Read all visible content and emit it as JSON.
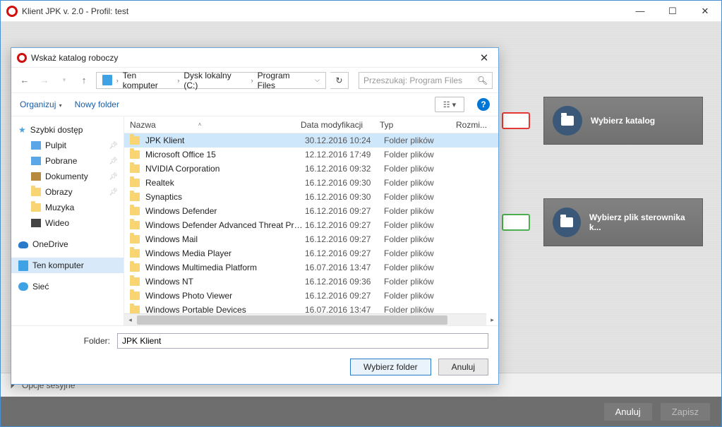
{
  "mainWindow": {
    "title": "Klient JPK v. 2.0 - Profil: test",
    "card1": "Wybierz katalog",
    "card2": "Wybierz plik sterownika k...",
    "session": "Opcje sesyjne",
    "footer": {
      "cancel": "Anuluj",
      "save": "Zapisz"
    }
  },
  "dialog": {
    "title": "Wskaż katalog roboczy",
    "breadcrumb": {
      "root": "Ten komputer",
      "drive": "Dysk lokalny (C:)",
      "folder": "Program Files"
    },
    "searchPlaceholder": "Przeszukaj: Program Files",
    "toolbar": {
      "organize": "Organizuj",
      "newFolder": "Nowy folder"
    },
    "tree": {
      "quick": "Szybki dostęp",
      "items": [
        {
          "label": "Pulpit",
          "pin": true,
          "icon": "blue"
        },
        {
          "label": "Pobrane",
          "pin": true,
          "icon": "blue"
        },
        {
          "label": "Dokumenty",
          "pin": true,
          "icon": "doc"
        },
        {
          "label": "Obrazy",
          "pin": true,
          "icon": "folder"
        },
        {
          "label": "Muzyka",
          "pin": false,
          "icon": "folder"
        },
        {
          "label": "Wideo",
          "pin": false,
          "icon": "vid"
        }
      ],
      "oneDrive": "OneDrive",
      "thisPc": "Ten komputer",
      "network": "Sieć"
    },
    "columns": {
      "name": "Nazwa",
      "date": "Data modyfikacji",
      "type": "Typ",
      "size": "Rozmi..."
    },
    "rows": [
      {
        "name": "JPK Klient",
        "date": "30.12.2016 10:24",
        "type": "Folder plików",
        "selected": true
      },
      {
        "name": "Microsoft Office 15",
        "date": "12.12.2016 17:49",
        "type": "Folder plików"
      },
      {
        "name": "NVIDIA Corporation",
        "date": "16.12.2016 09:32",
        "type": "Folder plików"
      },
      {
        "name": "Realtek",
        "date": "16.12.2016 09:30",
        "type": "Folder plików"
      },
      {
        "name": "Synaptics",
        "date": "16.12.2016 09:30",
        "type": "Folder plików"
      },
      {
        "name": "Windows Defender",
        "date": "16.12.2016 09:27",
        "type": "Folder plików"
      },
      {
        "name": "Windows Defender Advanced Threat Pro...",
        "date": "16.12.2016 09:27",
        "type": "Folder plików"
      },
      {
        "name": "Windows Mail",
        "date": "16.12.2016 09:27",
        "type": "Folder plików"
      },
      {
        "name": "Windows Media Player",
        "date": "16.12.2016 09:27",
        "type": "Folder plików"
      },
      {
        "name": "Windows Multimedia Platform",
        "date": "16.07.2016 13:47",
        "type": "Folder plików"
      },
      {
        "name": "Windows NT",
        "date": "16.12.2016 09:36",
        "type": "Folder plików"
      },
      {
        "name": "Windows Photo Viewer",
        "date": "16.12.2016 09:27",
        "type": "Folder plików"
      },
      {
        "name": "Windows Portable Devices",
        "date": "16.07.2016 13:47",
        "type": "Folder plików"
      }
    ],
    "folderLabel": "Folder:",
    "folderValue": "JPK Klient",
    "buttons": {
      "select": "Wybierz folder",
      "cancel": "Anuluj"
    }
  }
}
